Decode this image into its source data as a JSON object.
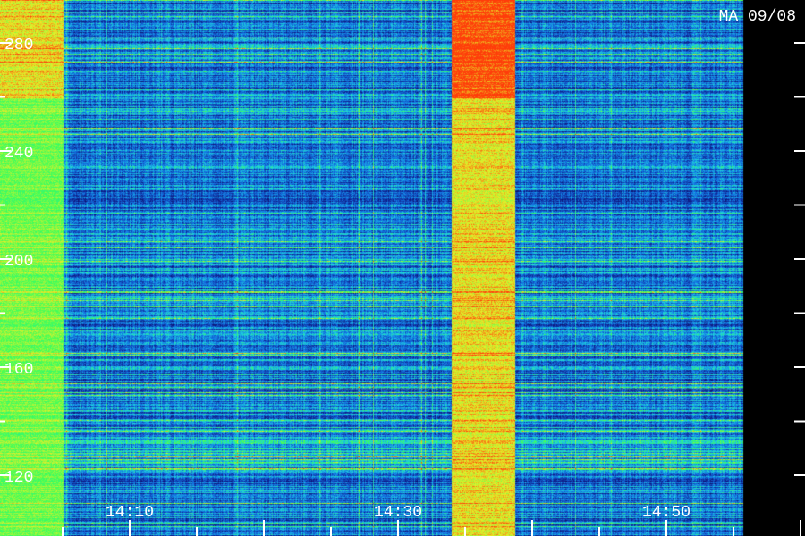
{
  "header": {
    "stamp": "MA 09/08"
  },
  "colors": {
    "background": "#000000",
    "axis": "#ffffff",
    "low": "#0a0a50",
    "mid": "#1a8cff",
    "high": "#30ff60",
    "peak": "#ff4010"
  },
  "chart_data": {
    "type": "heatmap",
    "title": "",
    "xlabel": "",
    "ylabel": "",
    "x_ticks": [
      "14:10",
      "14:30",
      "14:50"
    ],
    "y_ticks": [
      "120",
      "160",
      "200",
      "240",
      "280"
    ],
    "x_range_minutes": [
      0,
      54
    ],
    "y_range": [
      112,
      296
    ],
    "bright_bands": [
      {
        "start_minute": 0.0,
        "end_minute": 5.0,
        "level": 0.75
      },
      {
        "start_minute": 34.0,
        "end_minute": 38.7,
        "level": 0.85
      }
    ],
    "data_end_minute": 55.7,
    "grid": false,
    "legend": "none"
  }
}
